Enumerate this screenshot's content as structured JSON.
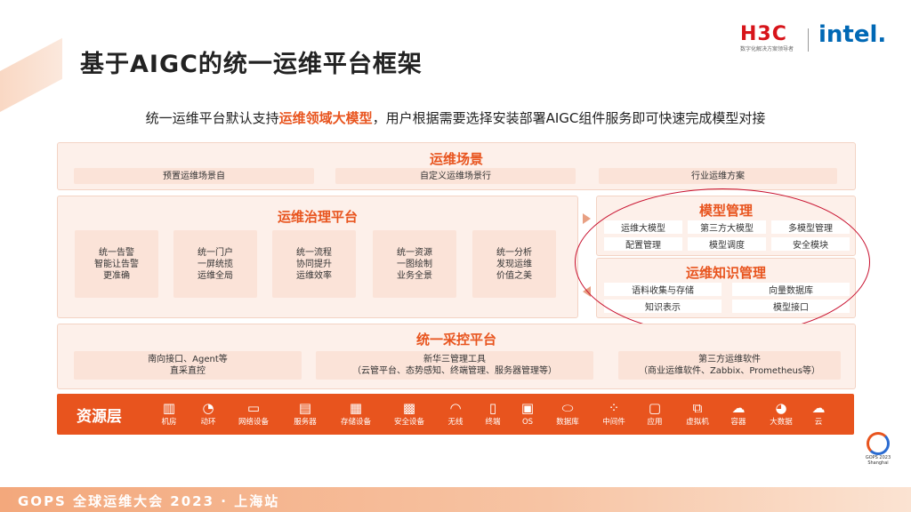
{
  "header": {
    "title": "基于AIGC的统一运维平台框架",
    "logo_h3c": "H3C",
    "logo_h3c_sub": "数字化解决方案领导者",
    "logo_intel": "intel."
  },
  "subtitle": {
    "pre": "统一运维平台默认支持",
    "highlight": "运维领域大模型",
    "post": "，用户根据需要选择安装部署AIGC组件服务即可快速完成模型对接"
  },
  "scene": {
    "title": "运维场景",
    "items": [
      "预置运维场景自",
      "自定义运维场景行",
      "行业运维方案"
    ]
  },
  "governance": {
    "title": "运维治理平台",
    "items": [
      "统一告警\n智能让告警\n更准确",
      "统一门户\n一屏统揽\n运维全局",
      "统一流程\n协同提升\n运维效率",
      "统一资源\n一图绘制\n业务全景",
      "统一分析\n发现运维\n价值之美"
    ]
  },
  "model_mgmt": {
    "title": "模型管理",
    "items": [
      "运维大模型",
      "第三方大模型",
      "多模型管理",
      "配置管理",
      "模型调度",
      "安全模块"
    ]
  },
  "knowledge_mgmt": {
    "title": "运维知识管理",
    "items": [
      "语料收集与存储",
      "向量数据库",
      "知识表示",
      "模型接口"
    ]
  },
  "collect": {
    "title": "统一采控平台",
    "items": [
      "南向接口、Agent等\n直采直控",
      "新华三管理工具\n（云管平台、态势感知、终端管理、服务器管理等）",
      "第三方运维软件\n（商业运维软件、Zabbix、Prometheus等）"
    ]
  },
  "resources": {
    "title": "资源层",
    "items": [
      {
        "label": "机房",
        "icon": "datacenter-icon"
      },
      {
        "label": "动环",
        "icon": "gauge-icon"
      },
      {
        "label": "网络设备",
        "icon": "network-device-icon"
      },
      {
        "label": "服务器",
        "icon": "server-icon"
      },
      {
        "label": "存储设备",
        "icon": "storage-icon"
      },
      {
        "label": "安全设备",
        "icon": "firewall-icon"
      },
      {
        "label": "无线",
        "icon": "wireless-icon"
      },
      {
        "label": "终端",
        "icon": "terminal-icon"
      },
      {
        "label": "OS",
        "icon": "os-icon"
      },
      {
        "label": "数据库",
        "icon": "database-icon"
      },
      {
        "label": "中间件",
        "icon": "middleware-icon"
      },
      {
        "label": "应用",
        "icon": "application-icon"
      },
      {
        "label": "虚拟机",
        "icon": "vm-icon"
      },
      {
        "label": "容器",
        "icon": "container-icon"
      },
      {
        "label": "大数据",
        "icon": "bigdata-icon"
      },
      {
        "label": "云",
        "icon": "cloud-icon"
      }
    ]
  },
  "footer": {
    "text": "GOPS 全球运维大会 2023 · 上海站",
    "badge_line1": "GOPS 2023",
    "badge_line2": "Shanghai"
  },
  "colors": {
    "accent": "#e8541e",
    "highlight_ring": "#c8102e",
    "panel_bg": "#fdf0ea",
    "card_bg": "#fbe3d8"
  }
}
